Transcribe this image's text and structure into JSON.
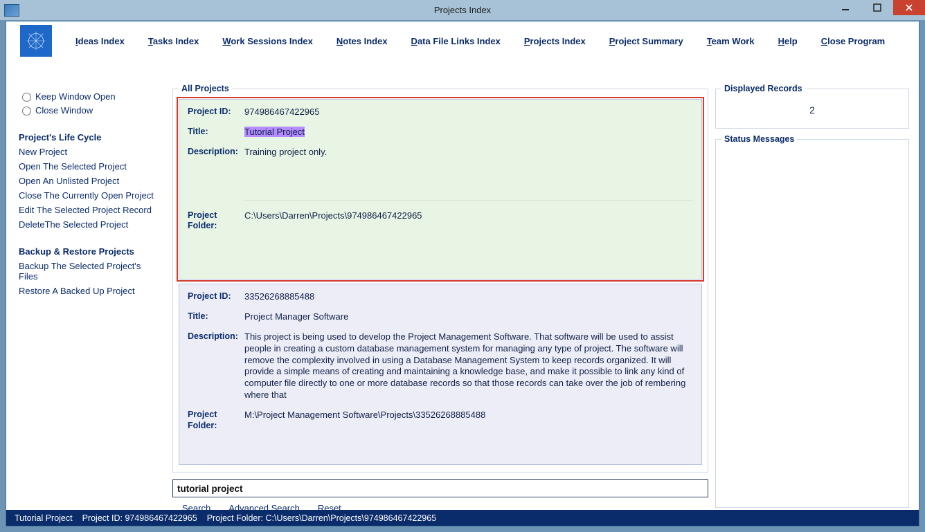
{
  "window": {
    "title": "Projects Index"
  },
  "menu": {
    "ideas": "Ideas Index",
    "tasks": "Tasks Index",
    "work": "Work Sessions Index",
    "notes": "Notes Index",
    "data": "Data File Links Index",
    "projects": "Projects Index",
    "summary": "Project Summary",
    "team": "Team Work",
    "help": "Help",
    "close": "Close Program"
  },
  "sidebar": {
    "keep_open": "Keep Window Open",
    "close_window": "Close Window",
    "heading_lifecycle": "Project's Life Cycle",
    "lifecycle": [
      "New Project",
      "Open The Selected Project",
      "Open An Unlisted Project",
      "Close The Currently Open Project",
      "Edit The Selected Project Record",
      "DeleteThe Selected Project"
    ],
    "heading_backup": "Backup & Restore Projects",
    "backup": [
      "Backup The Selected Project's Files",
      "Restore A Backed Up Project"
    ]
  },
  "all_projects_legend": "All Projects",
  "labels": {
    "project_id": "Project ID:",
    "title": "Title:",
    "description": "Description:",
    "folder": "Project Folder:"
  },
  "records": [
    {
      "id": "974986467422965",
      "title": "Tutorial Project",
      "description": "Training project only.",
      "folder": "C:\\Users\\Darren\\Projects\\974986467422965",
      "selected": true,
      "highlight_title": true
    },
    {
      "id": "33526268885488",
      "title": "Project Manager Software",
      "description": "This project is being used to develop the Project Management Software. That software will be used to assist people in creating a custom database management system for managing any type of project. The software will remove the complexity involved in using a Database Management System to keep records organized. It will provide a simple means of creating and maintaining a knowledge base, and make it possible to link any kind of computer file directly to one or more database records so that those records can take over the job of rembering where that",
      "folder": "M:\\Project Management Software\\Projects\\33526268885488",
      "selected": false
    }
  ],
  "search": {
    "value": "tutorial project",
    "search_label": "Search",
    "advanced_label": "Advanced Search",
    "reset_label": "Reset"
  },
  "displayed": {
    "legend": "Displayed Records",
    "count": "2"
  },
  "status_legend": "Status Messages",
  "statusbar": {
    "project": "Tutorial Project",
    "pid_label": "Project ID:",
    "pid": "974986467422965",
    "folder_label": "Project Folder:",
    "folder": "C:\\Users\\Darren\\Projects\\974986467422965"
  }
}
